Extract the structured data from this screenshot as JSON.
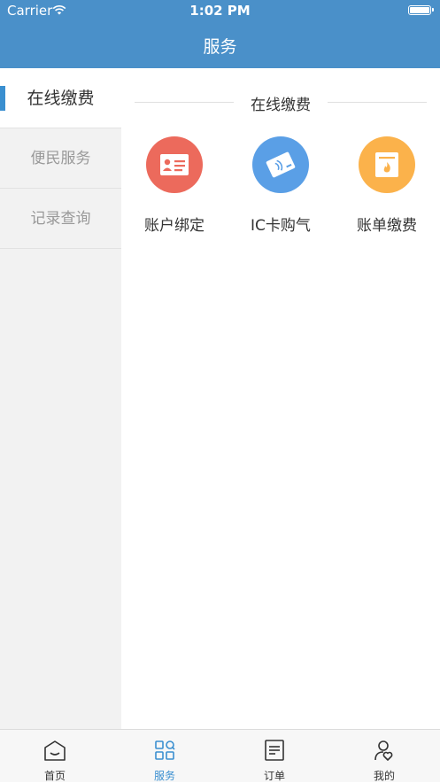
{
  "status_bar": {
    "carrier": "Carrier",
    "time": "1:02 PM"
  },
  "nav": {
    "title": "服务"
  },
  "sidebar": {
    "items": [
      {
        "label": "在线缴费",
        "active": true
      },
      {
        "label": "便民服务",
        "active": false
      },
      {
        "label": "记录查询",
        "active": false
      }
    ]
  },
  "main": {
    "section_title": "在线缴费",
    "services": [
      {
        "label": "账户绑定",
        "icon": "id-card-icon",
        "color": "#ec6a5c"
      },
      {
        "label": "IC卡购气",
        "icon": "ic-card-icon",
        "color": "#5a9fe6"
      },
      {
        "label": "账单缴费",
        "icon": "gas-bill-icon",
        "color": "#fbb24b"
      }
    ]
  },
  "tabbar": {
    "tabs": [
      {
        "label": "首页",
        "icon": "home-icon",
        "active": false
      },
      {
        "label": "服务",
        "icon": "services-grid-icon",
        "active": true
      },
      {
        "label": "订单",
        "icon": "order-list-icon",
        "active": false
      },
      {
        "label": "我的",
        "icon": "profile-icon",
        "active": false
      }
    ]
  },
  "colors": {
    "primary": "#4a90c9",
    "accent": "#3a8fd0",
    "sidebar_bg": "#f2f2f2"
  }
}
